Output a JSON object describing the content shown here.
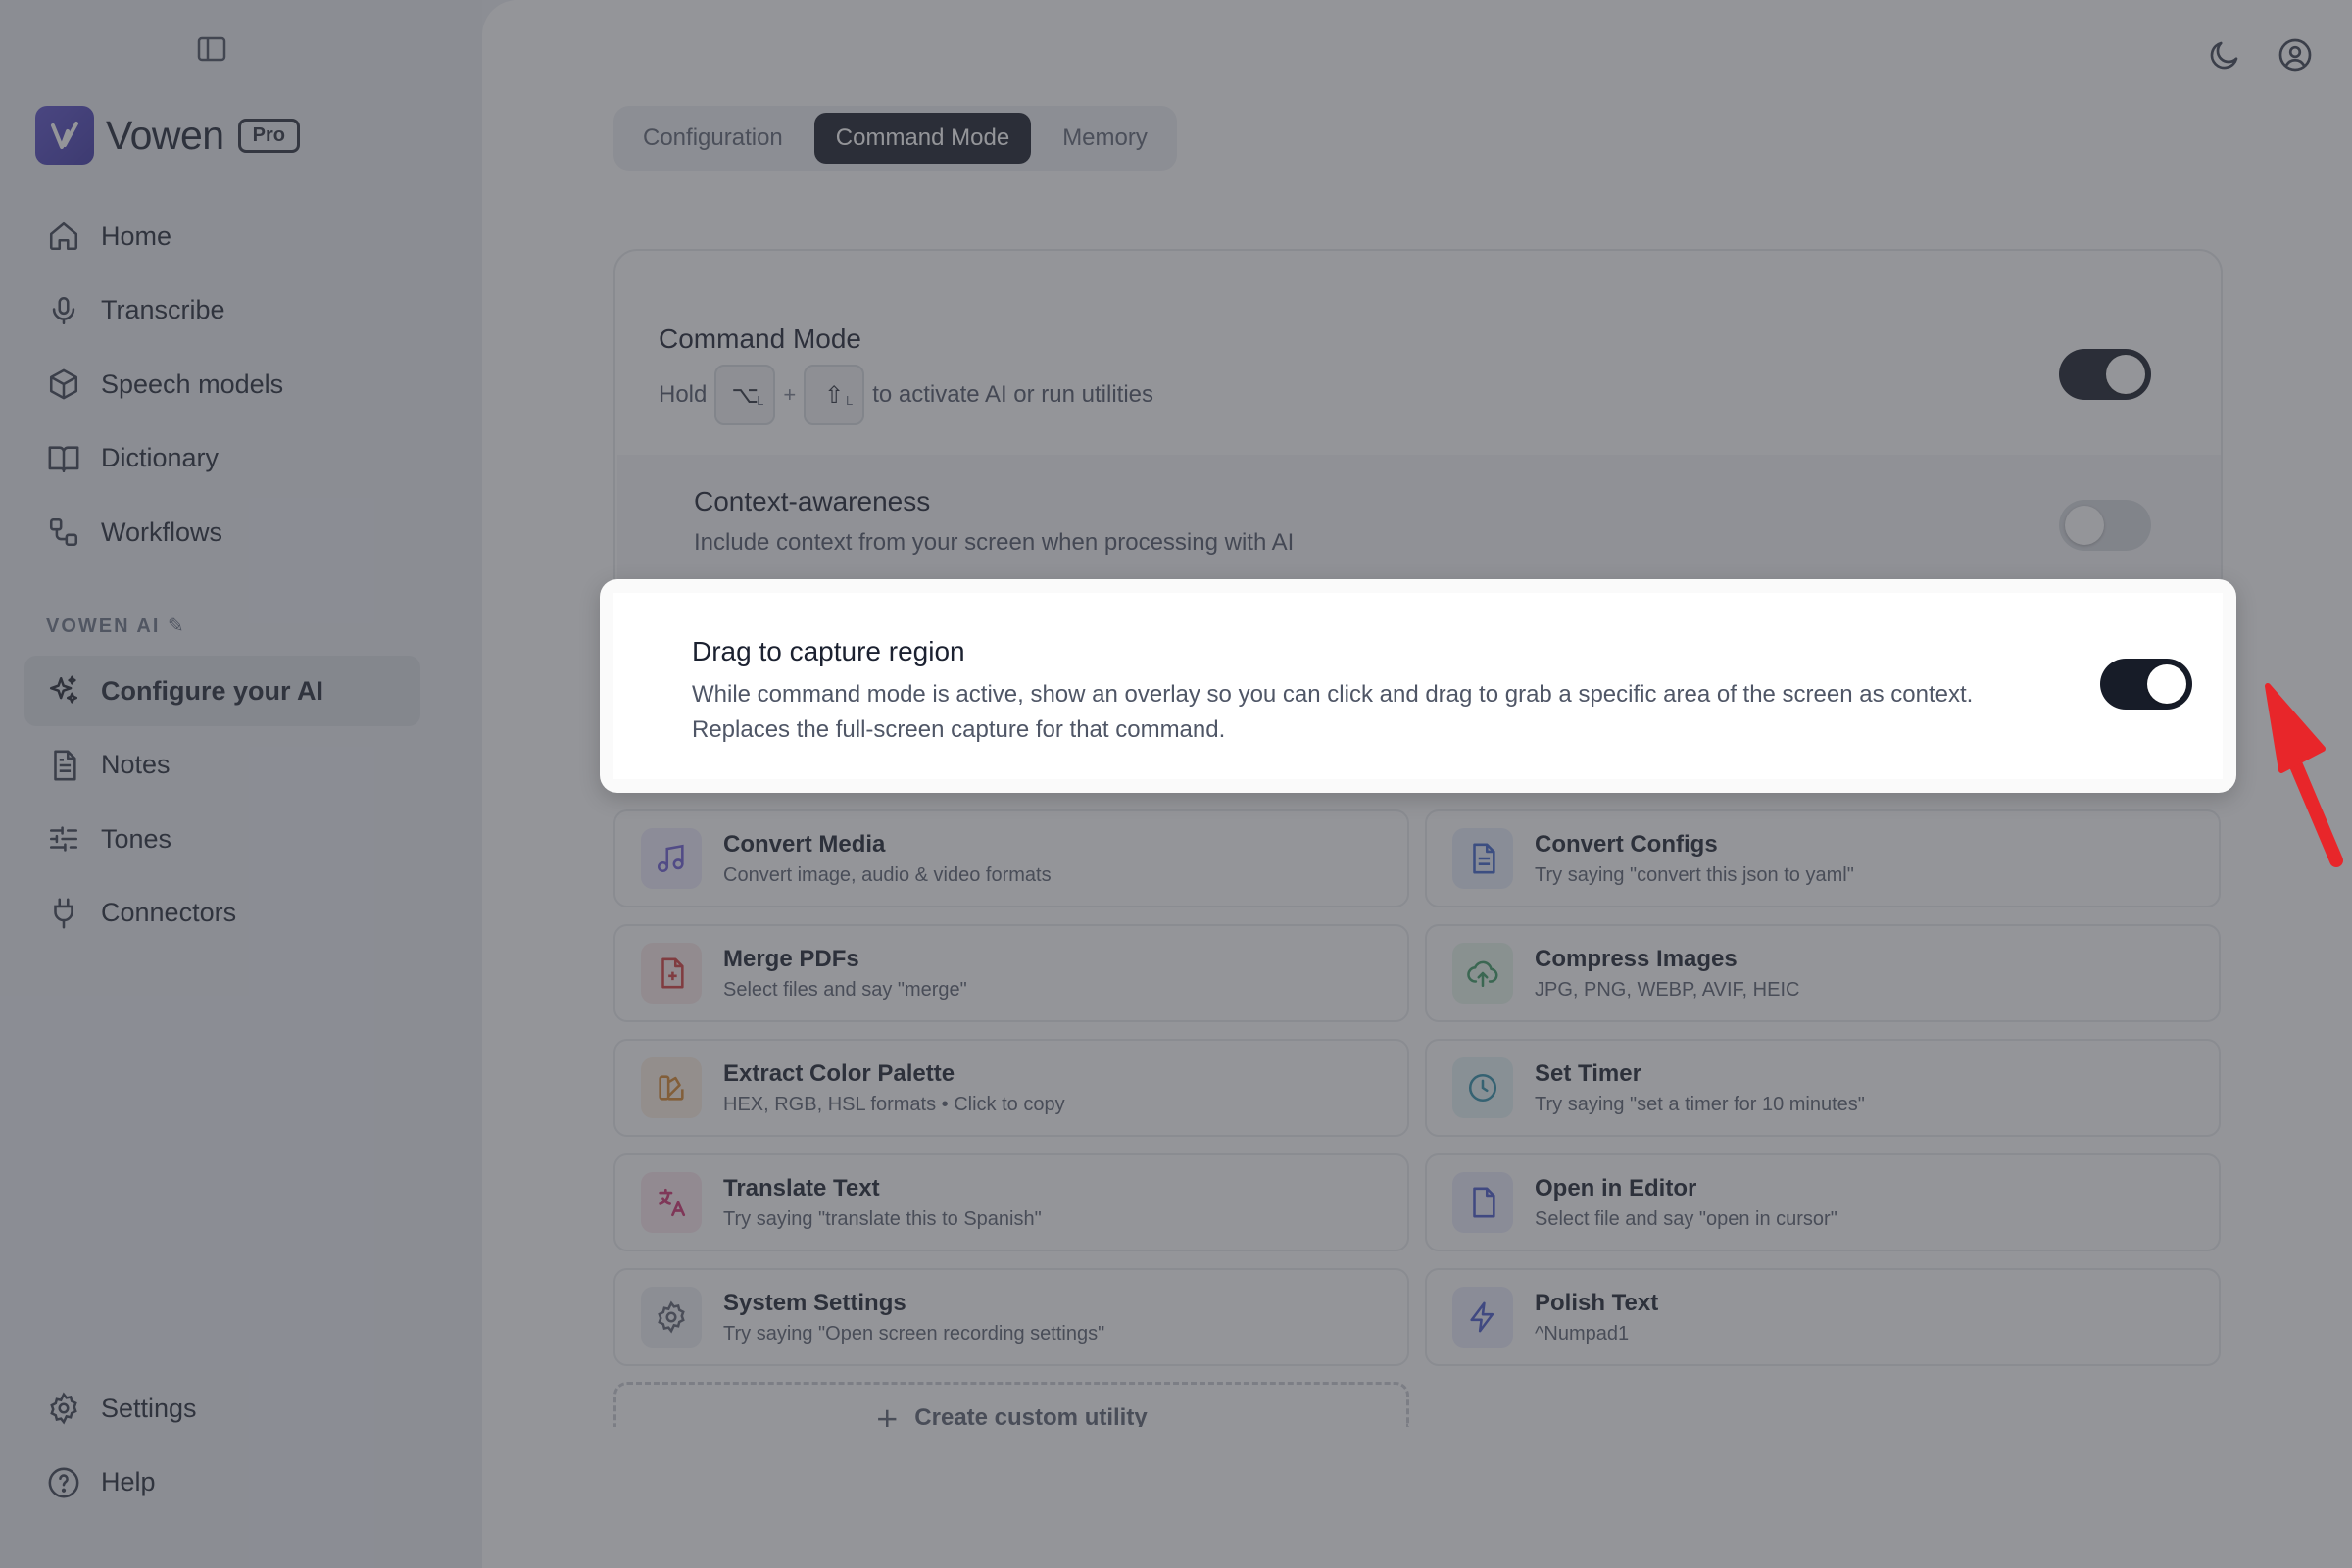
{
  "sidebar": {
    "brand_name": "Vowen",
    "brand_badge": "Pro",
    "items": [
      {
        "label": "Home",
        "icon": "home-icon"
      },
      {
        "label": "Transcribe",
        "icon": "microphone-icon"
      },
      {
        "label": "Speech models",
        "icon": "cube-icon"
      },
      {
        "label": "Dictionary",
        "icon": "book-icon"
      },
      {
        "label": "Workflows",
        "icon": "workflow-icon"
      }
    ],
    "section_label": "VOWEN AI",
    "ai_items": [
      {
        "label": "Configure your AI",
        "icon": "sparkles-icon",
        "active": true
      },
      {
        "label": "Notes",
        "icon": "note-icon"
      },
      {
        "label": "Tones",
        "icon": "sliders-icon"
      },
      {
        "label": "Connectors",
        "icon": "plug-icon"
      }
    ],
    "bottom_items": [
      {
        "label": "Settings",
        "icon": "gear-icon"
      },
      {
        "label": "Help",
        "icon": "help-icon"
      }
    ]
  },
  "tabs": [
    {
      "label": "Configuration",
      "active": false
    },
    {
      "label": "Command Mode",
      "active": true
    },
    {
      "label": "Memory",
      "active": false
    }
  ],
  "command_mode": {
    "title": "Command Mode",
    "hold": "Hold",
    "key1": "⌥",
    "key1_side": "L",
    "key2": "⇧",
    "key2_side": "L",
    "plus": "+",
    "desc_suffix": "to activate AI or run utilities",
    "enabled": true
  },
  "context_awareness": {
    "title": "Context-awareness",
    "desc": "Include context from your screen when processing with AI",
    "enabled": false
  },
  "drag_capture": {
    "title": "Drag to capture region",
    "desc_line1": "While command mode is active, show an overlay so you can click and drag to grab a specific area of the screen as context.",
    "desc_line2": "Replaces the full-screen capture for that command.",
    "enabled": true
  },
  "utilities": [
    {
      "title": "Convert Media",
      "sub": "Convert image, audio & video formats",
      "icon": "music-note-icon",
      "color": "#6b5bd6",
      "bg": "#eeeafc"
    },
    {
      "title": "Convert Configs",
      "sub": "Try saying \"convert this json to yaml\"",
      "icon": "document-icon",
      "color": "#3d63c9",
      "bg": "#e7eefb"
    },
    {
      "title": "Merge PDFs",
      "sub": "Select files and say \"merge\"",
      "icon": "file-plus-icon",
      "color": "#d23a3a",
      "bg": "#fbe9e9"
    },
    {
      "title": "Compress Images",
      "sub": "JPG, PNG, WEBP, AVIF, HEIC",
      "icon": "cloud-upload-icon",
      "color": "#3a9a63",
      "bg": "#e6f5ec"
    },
    {
      "title": "Extract Color Palette",
      "sub": "HEX, RGB, HSL formats • Click to copy",
      "icon": "palette-icon",
      "color": "#d7862a",
      "bg": "#fcf0e2"
    },
    {
      "title": "Set Timer",
      "sub": "Try saying \"set a timer for 10 minutes\"",
      "icon": "clock-icon",
      "color": "#2e8fa8",
      "bg": "#e4f3f7"
    },
    {
      "title": "Translate Text",
      "sub": "Try saying \"translate this to Spanish\"",
      "icon": "translate-icon",
      "color": "#d0306f",
      "bg": "#fbe6ee"
    },
    {
      "title": "Open in Editor",
      "sub": "Select file and say \"open in cursor\"",
      "icon": "file-icon",
      "color": "#4657c9",
      "bg": "#e9ebfb"
    },
    {
      "title": "System Settings",
      "sub": "Try saying \"Open screen recording settings\"",
      "icon": "gear-icon",
      "color": "#5b6170",
      "bg": "#eef0f3"
    },
    {
      "title": "Polish Text",
      "sub": "^Numpad1",
      "icon": "lightning-icon",
      "color": "#4657c9",
      "bg": "#e9ebfb"
    }
  ],
  "create_custom": "Create custom utility"
}
